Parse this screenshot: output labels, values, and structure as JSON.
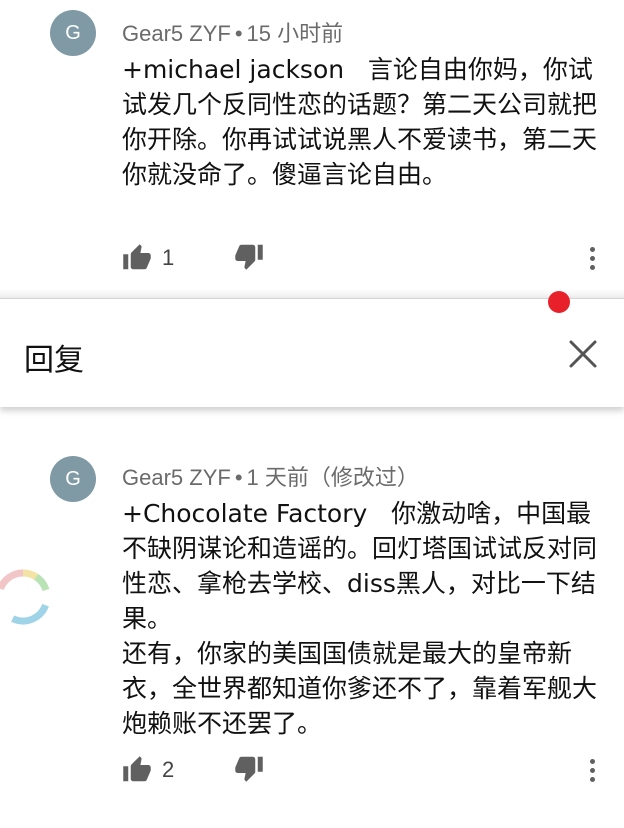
{
  "comments": [
    {
      "avatar_letter": "G",
      "author": "Gear5 ZYF",
      "separator": "•",
      "time": "15 小时前",
      "text": "+michael jackson   言论自由你妈，你试试发几个反同性恋的话题？第二天公司就把你开除。你再试试说黑人不爱读书，第二天你就没命了。傻逼言论自由。",
      "like_count": "1"
    },
    {
      "avatar_letter": "G",
      "author": "Gear5 ZYF",
      "separator": "•",
      "time": "1 天前（修改过）",
      "text": "+Chocolate Factory   你激动啥，中国最不缺阴谋论和造谣的。回灯塔国试试反对同性恋、拿枪去学校、diss黑人，对比一下结果。\n还有，你家的美国国债就是最大的皇帝新衣，全世界都知道你爹还不了，靠着军舰大炮赖账不还罢了。",
      "like_count": "2"
    }
  ],
  "reply_bar": {
    "title": "回复"
  },
  "colors": {
    "avatar": "#7f9aa5",
    "accent_red": "#e8202a"
  }
}
